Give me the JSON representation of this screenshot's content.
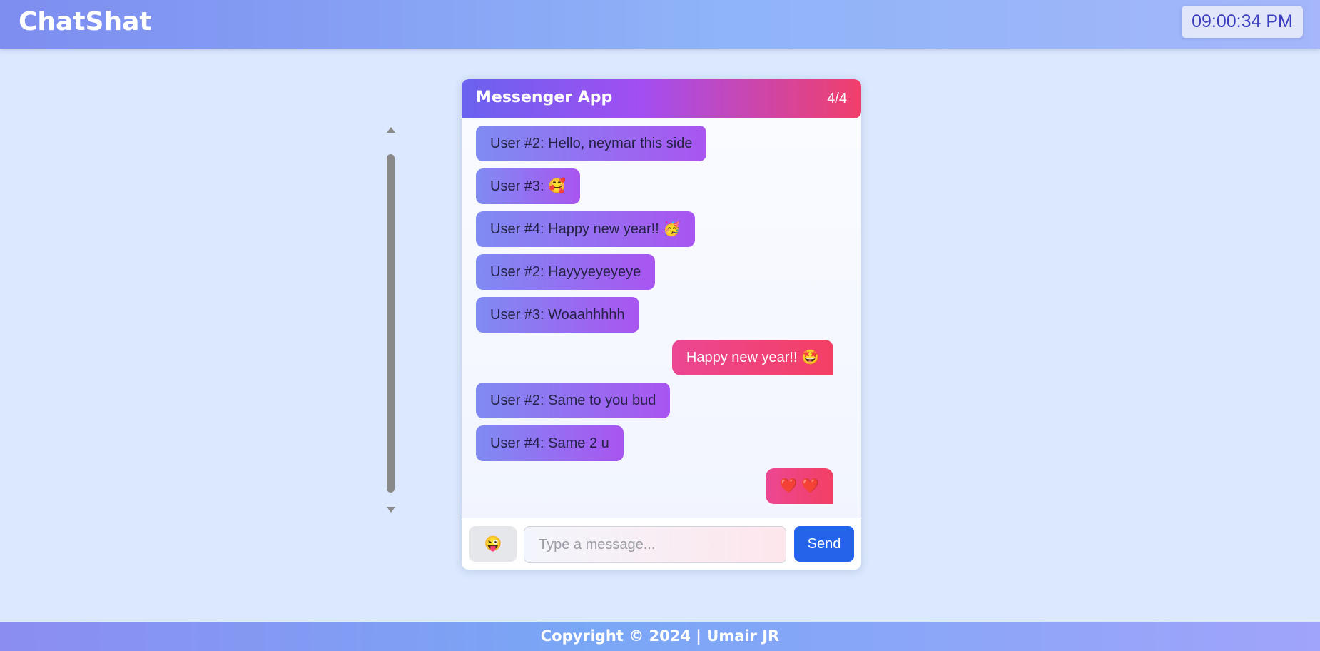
{
  "app": {
    "brand": "ChatShat",
    "clock": "09:00:34 PM"
  },
  "chat": {
    "title": "Messenger App",
    "count": "4/4",
    "messages": [
      {
        "direction": "in",
        "text": "User #2: Hello, neymar this side"
      },
      {
        "direction": "in",
        "text": "User #3: 🥰"
      },
      {
        "direction": "in",
        "text": "User #4: Happy new year!! 🥳"
      },
      {
        "direction": "in",
        "text": "User #2: Hayyyeyeyeye"
      },
      {
        "direction": "in",
        "text": "User #3: Woaahhhhh"
      },
      {
        "direction": "out",
        "text": "Happy new year!! 🤩"
      },
      {
        "direction": "in",
        "text": "User #2: Same to you bud"
      },
      {
        "direction": "in",
        "text": "User #4: Same 2 u"
      },
      {
        "direction": "out",
        "text": "❤️ ❤️"
      }
    ]
  },
  "composer": {
    "emoji_button": "😜",
    "placeholder": "Type a message...",
    "value": "",
    "send_label": "Send"
  },
  "footer": {
    "text": "Copyright © 2024 | Umair JR"
  },
  "colors": {
    "incoming_bubble": "#8b6cf1",
    "outgoing_bubble": "#ef4479",
    "send_button": "#2563eb",
    "page_background": "#dbe8fd"
  }
}
